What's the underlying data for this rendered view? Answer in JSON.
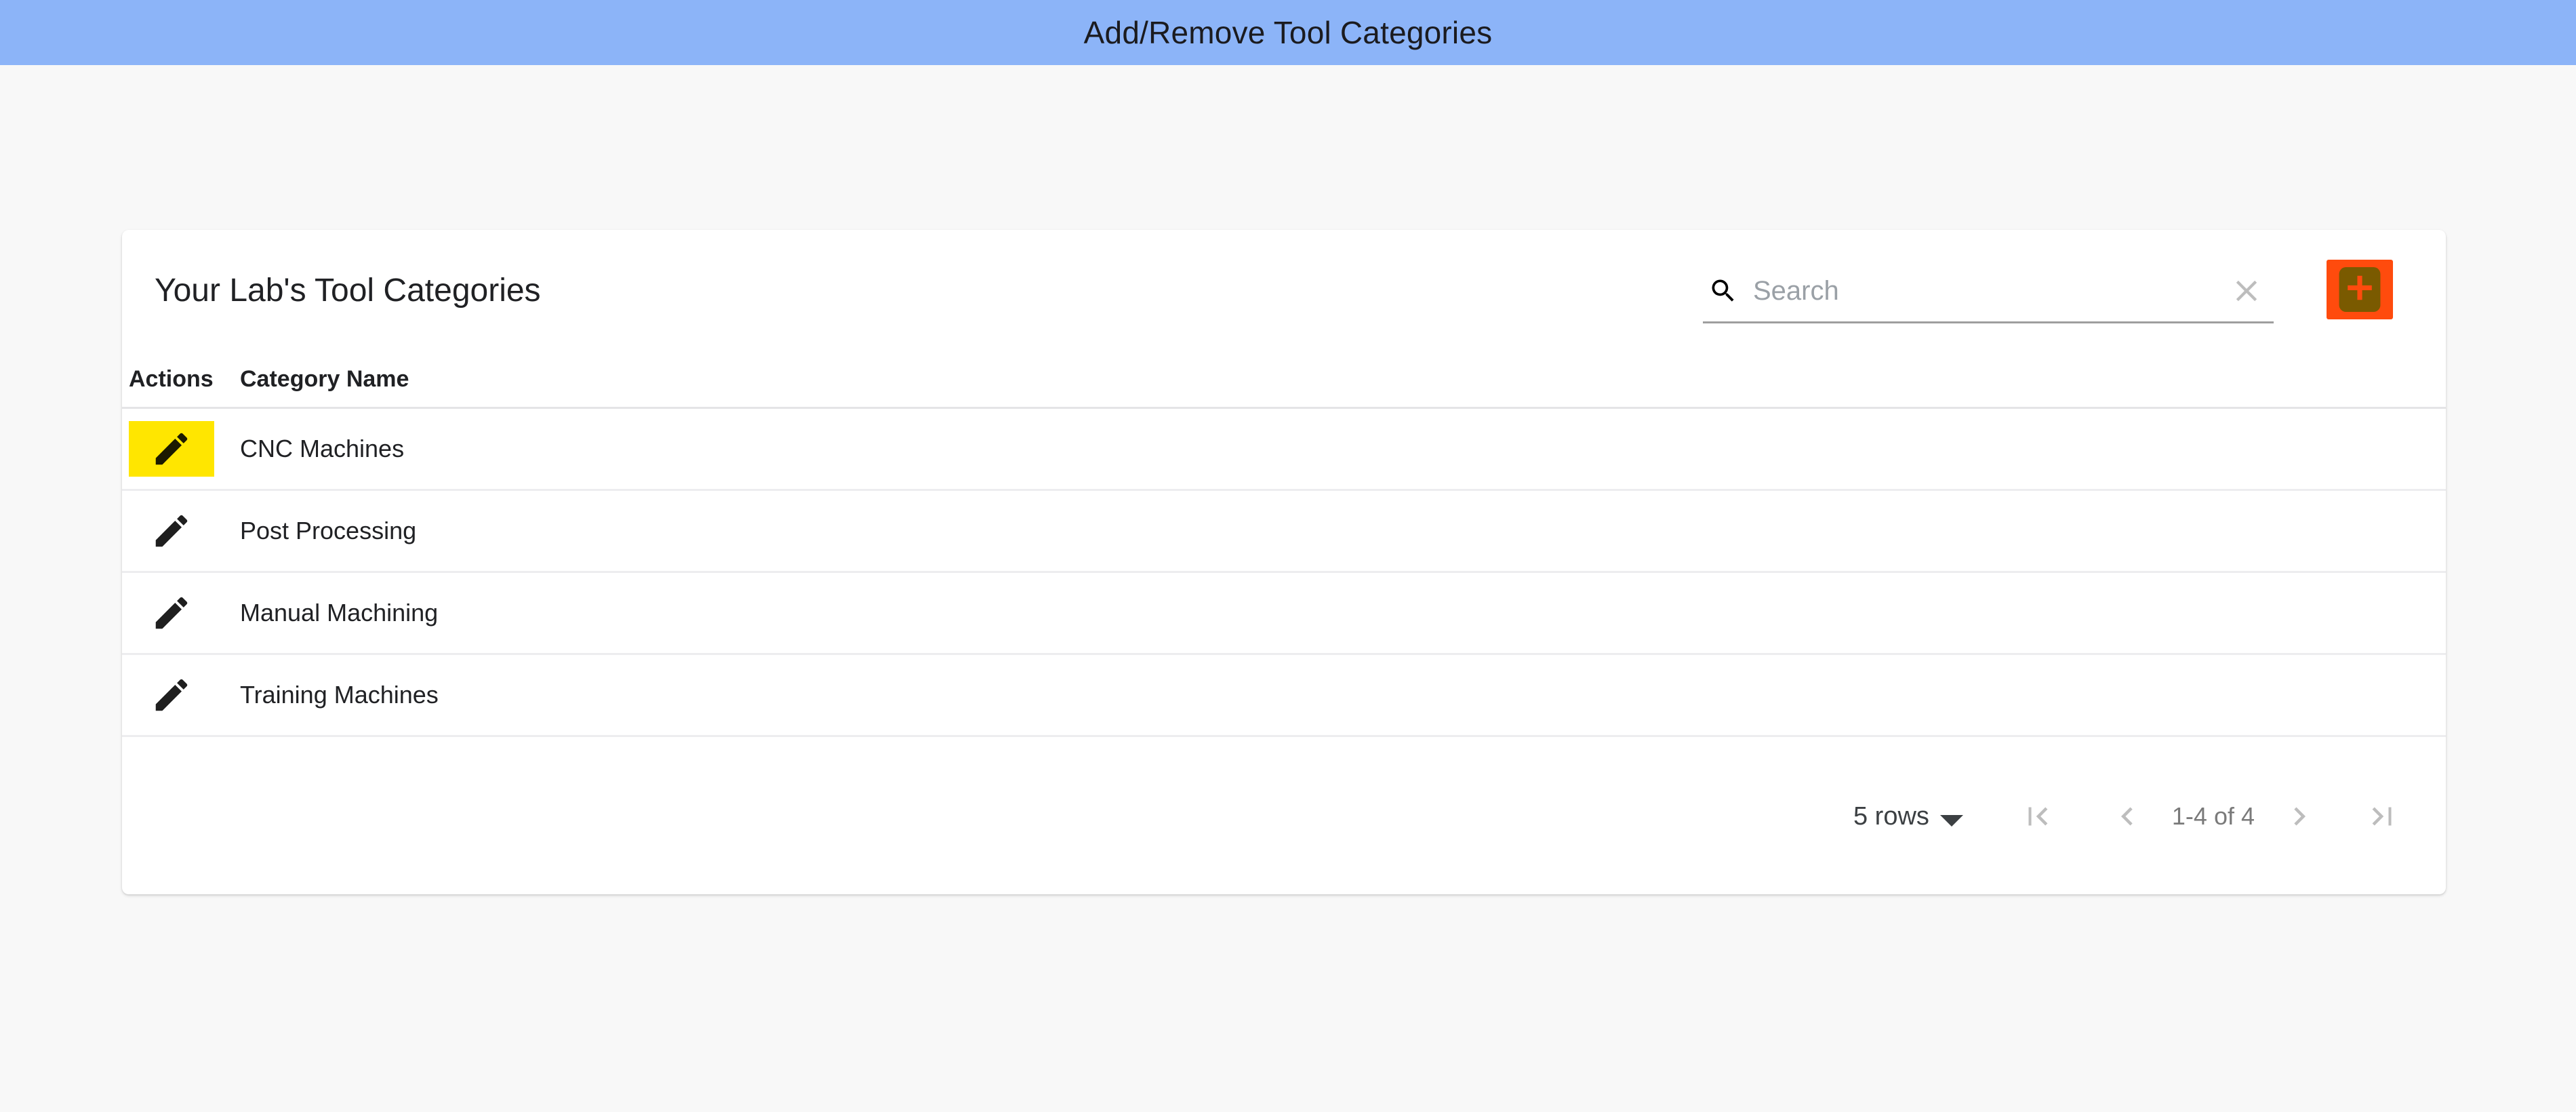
{
  "banner": {
    "title": "Add/Remove Tool Categories",
    "background_color": "#8CB4F8"
  },
  "card": {
    "title": "Your Lab's Tool Categories"
  },
  "search": {
    "placeholder": "Search",
    "value": "",
    "icon": "search-icon",
    "clear_icon": "close-icon"
  },
  "add_button": {
    "icon": "plus-icon",
    "label": "Add",
    "background_color": "#FF4B0D",
    "glyph_color": "#7A5A00"
  },
  "table": {
    "columns": [
      "Actions",
      "Category Name"
    ],
    "rows": [
      {
        "name": "CNC Machines",
        "action_icon": "edit-pencil-icon",
        "highlighted": true,
        "highlight_color": "#FFE600"
      },
      {
        "name": "Post Processing",
        "action_icon": "edit-pencil-icon",
        "highlighted": false,
        "highlight_color": ""
      },
      {
        "name": "Manual Machining",
        "action_icon": "edit-pencil-icon",
        "highlighted": false,
        "highlight_color": ""
      },
      {
        "name": "Training Machines",
        "action_icon": "edit-pencil-icon",
        "highlighted": false,
        "highlight_color": ""
      }
    ]
  },
  "pagination": {
    "rows_per_page_label": "5 rows",
    "rows_per_page_value": "5",
    "range_label": "1-4 of 4",
    "first_icon": "first-page-icon",
    "prev_icon": "chevron-left-icon",
    "next_icon": "chevron-right-icon",
    "last_icon": "last-page-icon",
    "arrow_color": "#BDBDBD"
  }
}
